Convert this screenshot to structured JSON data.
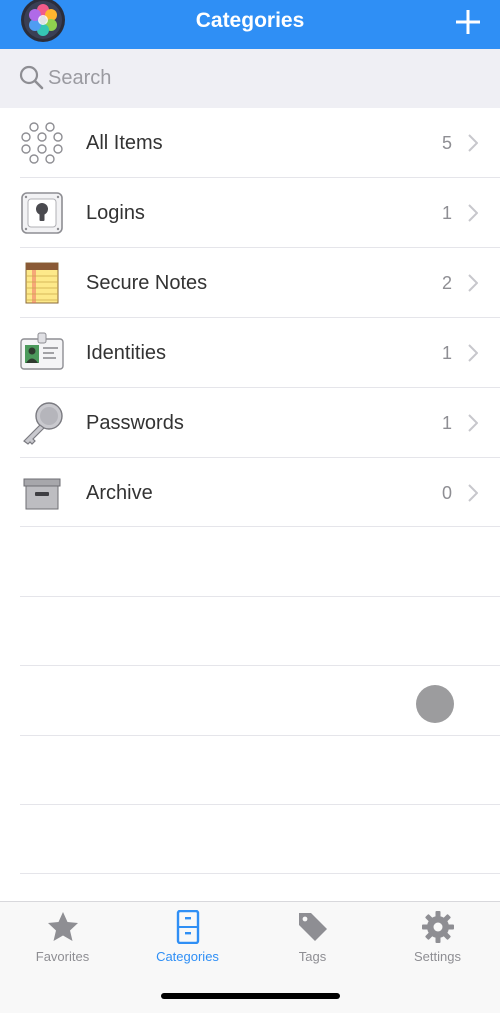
{
  "header": {
    "title": "Categories",
    "add_label": "+"
  },
  "search": {
    "placeholder": "Search"
  },
  "categories": [
    {
      "label": "All Items",
      "count": "5",
      "icon": "all-items-icon"
    },
    {
      "label": "Logins",
      "count": "1",
      "icon": "login-icon"
    },
    {
      "label": "Secure Notes",
      "count": "2",
      "icon": "secure-notes-icon"
    },
    {
      "label": "Identities",
      "count": "1",
      "icon": "identity-card-icon"
    },
    {
      "label": "Passwords",
      "count": "1",
      "icon": "key-icon"
    },
    {
      "label": "Archive",
      "count": "0",
      "icon": "archive-box-icon"
    }
  ],
  "tabs": [
    {
      "label": "Favorites",
      "icon": "star-icon",
      "active": false
    },
    {
      "label": "Categories",
      "icon": "file-cabinet-icon",
      "active": true
    },
    {
      "label": "Tags",
      "icon": "tag-icon",
      "active": false
    },
    {
      "label": "Settings",
      "icon": "gear-icon",
      "active": false
    }
  ],
  "colors": {
    "accent": "#2f8ff5",
    "inactive": "#8e8e93",
    "search_bg": "#efeff4"
  }
}
